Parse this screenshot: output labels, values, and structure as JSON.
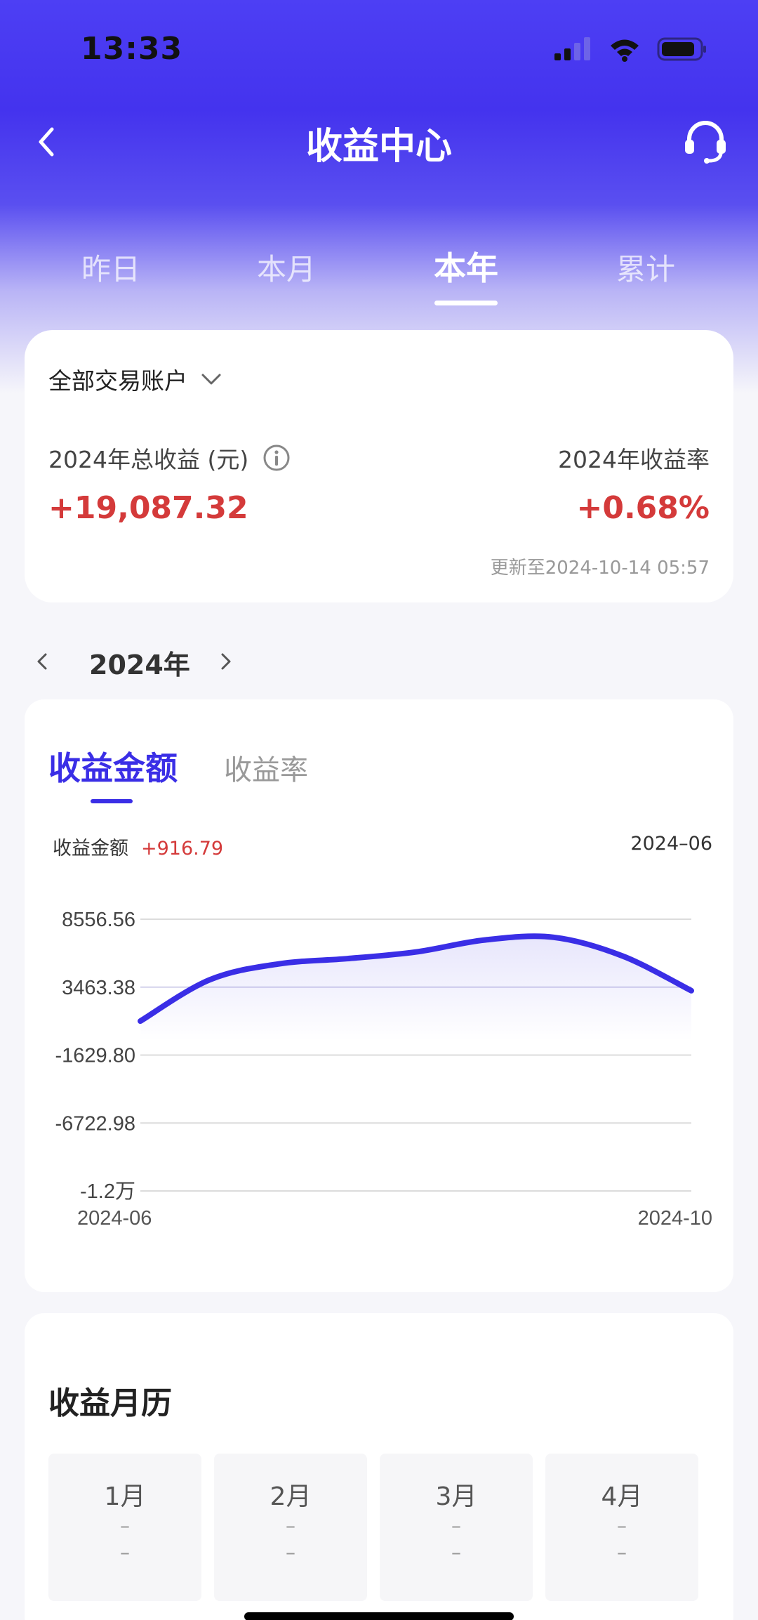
{
  "status": {
    "time": "13:33"
  },
  "nav": {
    "title": "收益中心"
  },
  "period_tabs": [
    {
      "label": "昨日"
    },
    {
      "label": "本月"
    },
    {
      "label": "本年"
    },
    {
      "label": "累计"
    }
  ],
  "active_period": "本年",
  "summary": {
    "account": "全部交易账户",
    "total_label": "2024年总收益 (元)",
    "total_value": "+19,087.32",
    "rate_label": "2024年收益率",
    "rate_value": "+0.68%",
    "updated": "更新至2024-10-14 05:57"
  },
  "year_selector": {
    "year": "2024年"
  },
  "chart_tabs": {
    "active": "收益金额",
    "inactive": "收益率"
  },
  "chart_info": {
    "label": "收益金额",
    "value": "+916.79",
    "month": "2024–06"
  },
  "chart_data": {
    "type": "area",
    "yticks": [
      "8556.56",
      "3463.38",
      "-1629.80",
      "-6722.98",
      "-1.2万"
    ],
    "ytick_values": [
      8556.56,
      3463.38,
      -1629.8,
      -6722.98,
      -11816.16
    ],
    "x_start": "2024-06",
    "x_end": "2024-10",
    "series": [
      {
        "values": [
          916.79,
          4000,
          5200,
          5600,
          6100,
          7000,
          7200,
          5800,
          3200
        ]
      }
    ],
    "line_color": "#3a2ee6"
  },
  "calendar": {
    "title": "收益月历",
    "months": [
      {
        "name": "1月",
        "v1": "–",
        "v2": "–"
      },
      {
        "name": "2月",
        "v1": "–",
        "v2": "–"
      },
      {
        "name": "3月",
        "v1": "–",
        "v2": "–"
      },
      {
        "name": "4月",
        "v1": "–",
        "v2": "–"
      }
    ]
  },
  "colors": {
    "accent": "#3a2ee6",
    "gain": "#d43a3a"
  }
}
